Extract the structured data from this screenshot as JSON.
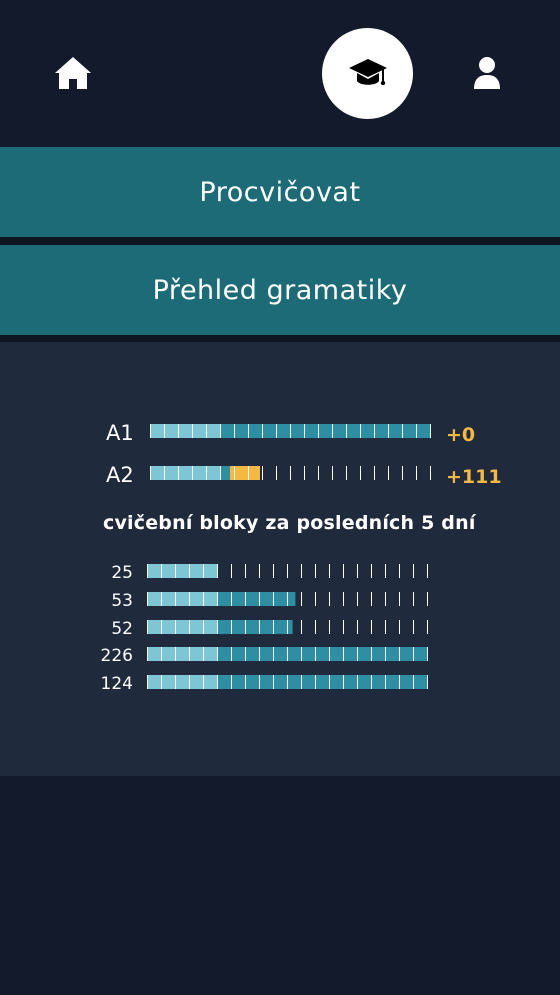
{
  "nav": {
    "home_icon": "home-icon",
    "center_icon": "graduation-cap-icon",
    "profile_icon": "user-icon"
  },
  "menu": {
    "practice_label": "Procvičovat",
    "grammar_label": "Přehled gramatiky"
  },
  "levels": [
    {
      "label": "A1",
      "delta": "+0",
      "base_progress": 0.25,
      "gain_progress": 0.0,
      "extra_progress": 0.75
    },
    {
      "label": "A2",
      "delta": "+111",
      "base_progress": 0.2857,
      "gain_progress": 0.1071,
      "extra_progress": 0.0
    }
  ],
  "recent": {
    "heading": "cvičební bloky za posledních 5 dní",
    "days": [
      {
        "count": "25",
        "progress": 0.25
      },
      {
        "count": "53",
        "progress": 0.53
      },
      {
        "count": "52",
        "progress": 0.52
      },
      {
        "count": "226",
        "progress": 1.0
      },
      {
        "count": "124",
        "progress": 1.0
      }
    ]
  },
  "colors": {
    "background": "#131a2b",
    "panel": "#1f2a3d",
    "menu_button": "#1e6b78",
    "bar_light": "#7cc6d6",
    "bar_teal": "#2e8fa4",
    "gain": "#f5b942"
  }
}
